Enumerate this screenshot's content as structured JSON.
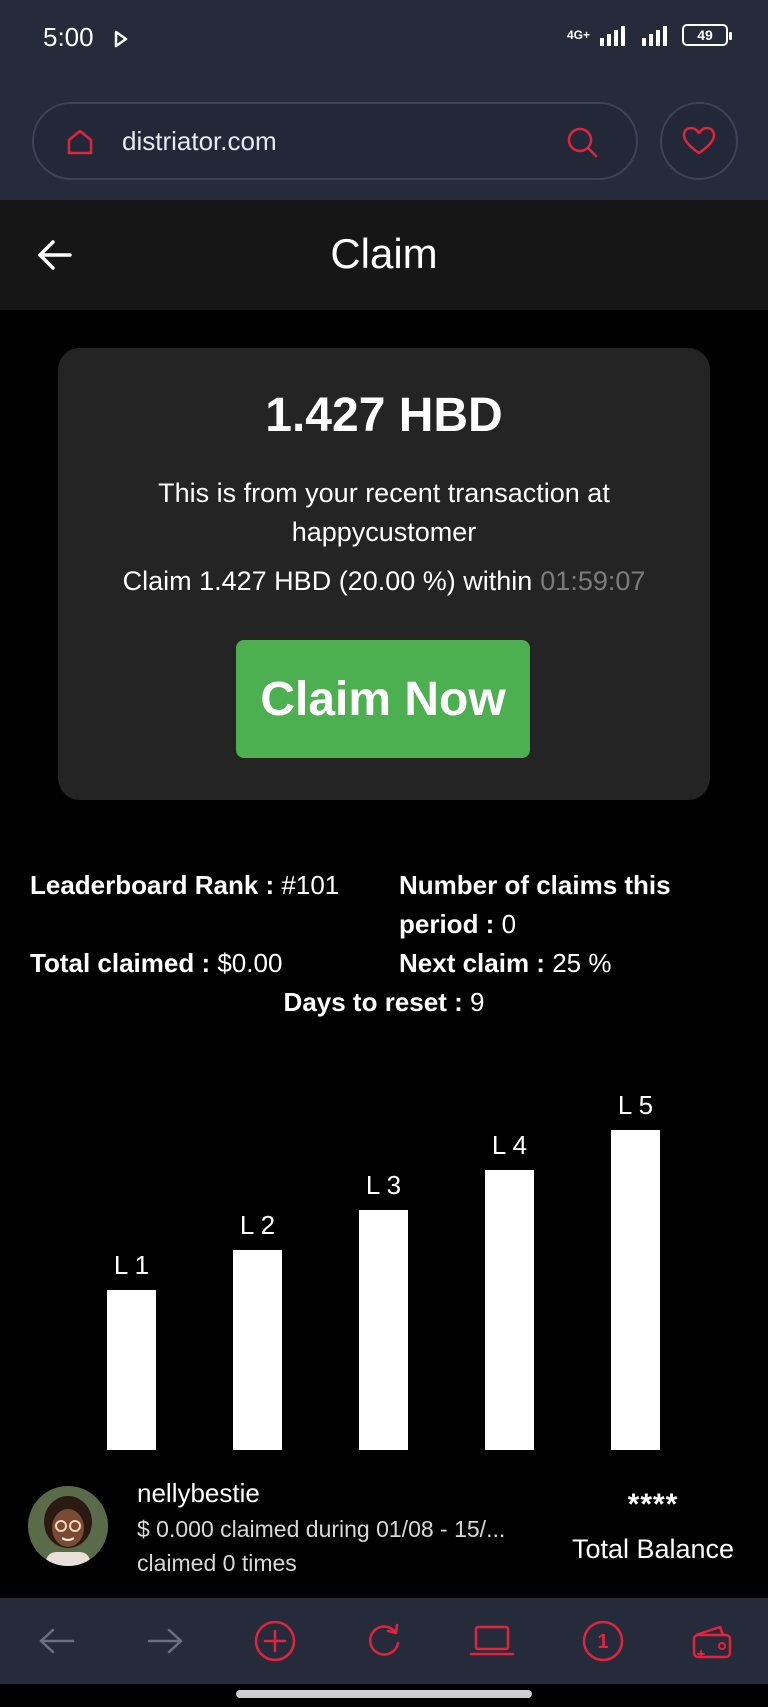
{
  "status_bar": {
    "time": "5:00",
    "network": "4G+",
    "battery": "49"
  },
  "browser": {
    "url": "distriator.com",
    "accent_color": "#e0243c"
  },
  "header": {
    "title": "Claim"
  },
  "claim_card": {
    "amount": "1.427 HBD",
    "description": "This is from your recent transaction at happycustomer",
    "claim_text": "Claim 1.427 HBD (20.00 %) within",
    "timer": "01:59:07",
    "button_label": "Claim Now",
    "button_color": "#4caf50"
  },
  "stats": {
    "rank_label": "Leaderboard Rank :",
    "rank_value": "#101",
    "claims_label_line1": "Number of claims this",
    "claims_label_line2": "period :",
    "claims_value": "0",
    "total_label": "Total claimed :",
    "total_value": "$0.00",
    "next_label": "Next claim :",
    "next_value": "25 %",
    "reset_label": "Days to reset :",
    "reset_value": "9"
  },
  "chart_data": {
    "type": "bar",
    "categories": [
      "L 1",
      "L 2",
      "L 3",
      "L 4",
      "L 5"
    ],
    "values": [
      1,
      1.25,
      1.5,
      1.75,
      2
    ],
    "title": "",
    "xlabel": "",
    "ylabel": "",
    "ylim": [
      0,
      2
    ],
    "grid": false,
    "bar_color": "#ffffff"
  },
  "user": {
    "name": "nellybestie",
    "claimed": "$ 0.000 claimed during 01/08 - 15/...",
    "times": "claimed 0 times",
    "balance_masked": "****",
    "balance_label": "Total Balance"
  },
  "bottom_nav": {
    "tab_count": "1",
    "icons": [
      "arrow-left-icon",
      "arrow-right-icon",
      "plus-icon",
      "refresh-icon",
      "laptop-icon",
      "tabs-icon",
      "wallet-icon"
    ]
  }
}
